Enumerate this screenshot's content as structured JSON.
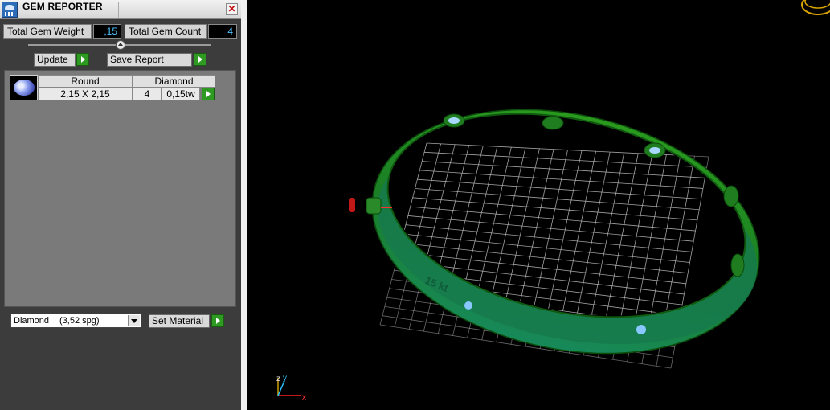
{
  "panel": {
    "title": "GEM REPORTER",
    "close_glyph": "✕",
    "total_weight_label": "Total Gem Weight",
    "total_weight_value": ",15",
    "total_count_label": "Total Gem Count",
    "total_count_value": "4",
    "update_label": "Update",
    "save_report_label": "Save Report",
    "set_material_label": "Set Material",
    "material": {
      "name": "Diamond",
      "spg": "(3,52 spg)"
    }
  },
  "gem_list": {
    "headers": [
      "Round",
      "Diamond"
    ],
    "rows": [
      {
        "size": "2,15 X 2,15",
        "count": "4",
        "weight": "0,15tw"
      }
    ]
  },
  "viewport": {
    "axis_labels": {
      "x": "x",
      "y": "y",
      "z": "z"
    },
    "engraving": "15 kt",
    "colors": {
      "ring": "#1f8f1f",
      "axis_x": "#ff2020",
      "axis_y": "#20c0ff",
      "grid": "#bdbdbd"
    }
  },
  "icons": [
    "app-icon",
    "close-icon",
    "play-arrow-icon",
    "dropdown-arrow-icon",
    "round-gem-icon"
  ]
}
